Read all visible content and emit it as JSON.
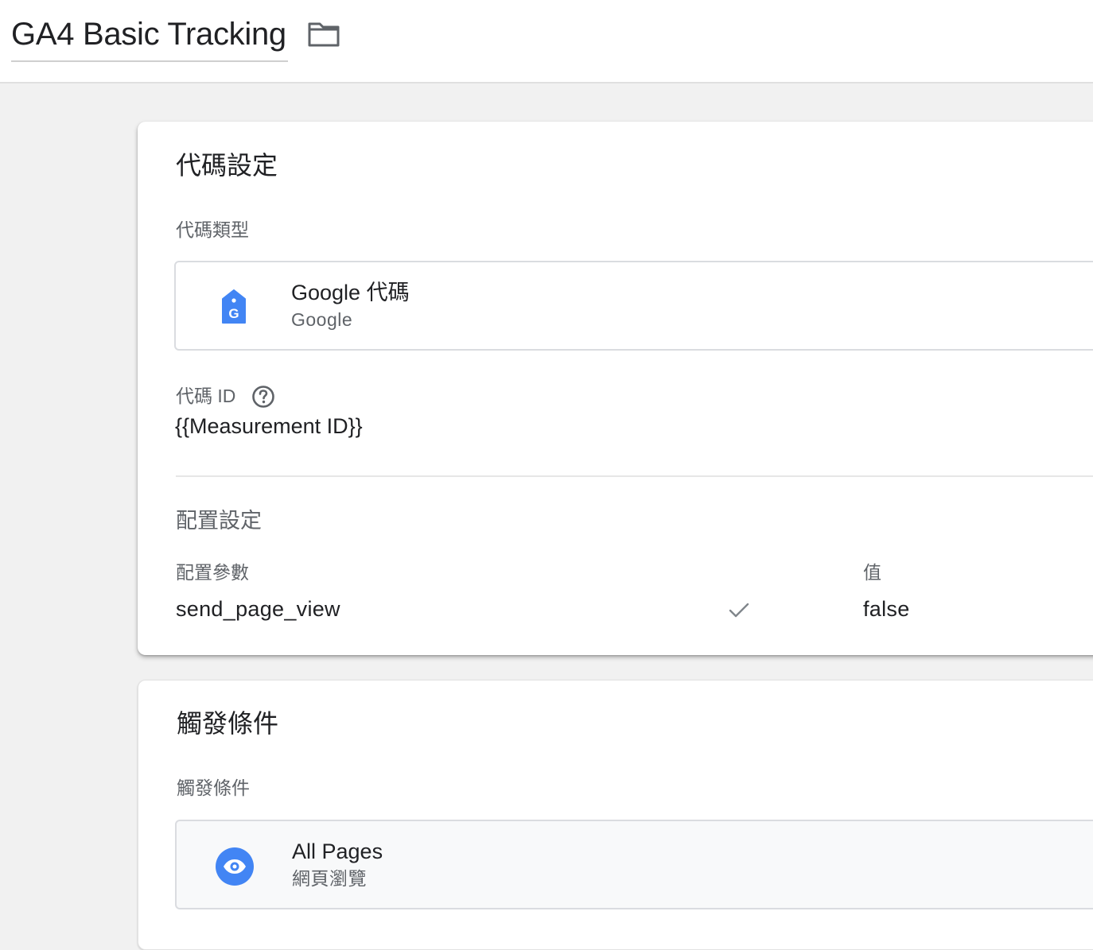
{
  "header": {
    "title": "GA4 Basic Tracking",
    "folder_icon": "folder-icon"
  },
  "tag_config": {
    "title": "代碼設定",
    "type_label": "代碼類型",
    "tag_type": {
      "name": "Google 代碼",
      "vendor": "Google",
      "icon": "google-tag-icon",
      "icon_color": "#4285f4"
    },
    "id_label": "代碼 ID",
    "help_icon": "help-circle-icon",
    "id_value": "{{Measurement ID}}",
    "settings": {
      "title": "配置設定",
      "param_header": "配置參數",
      "value_header": "值",
      "rows": [
        {
          "param": "send_page_view",
          "value": "false",
          "check_icon": "check-icon"
        }
      ]
    }
  },
  "triggering": {
    "title": "觸發條件",
    "label": "觸發條件",
    "trigger": {
      "name": "All Pages",
      "type": "網頁瀏覽",
      "icon": "eye-icon",
      "icon_color": "#4285f4"
    }
  }
}
